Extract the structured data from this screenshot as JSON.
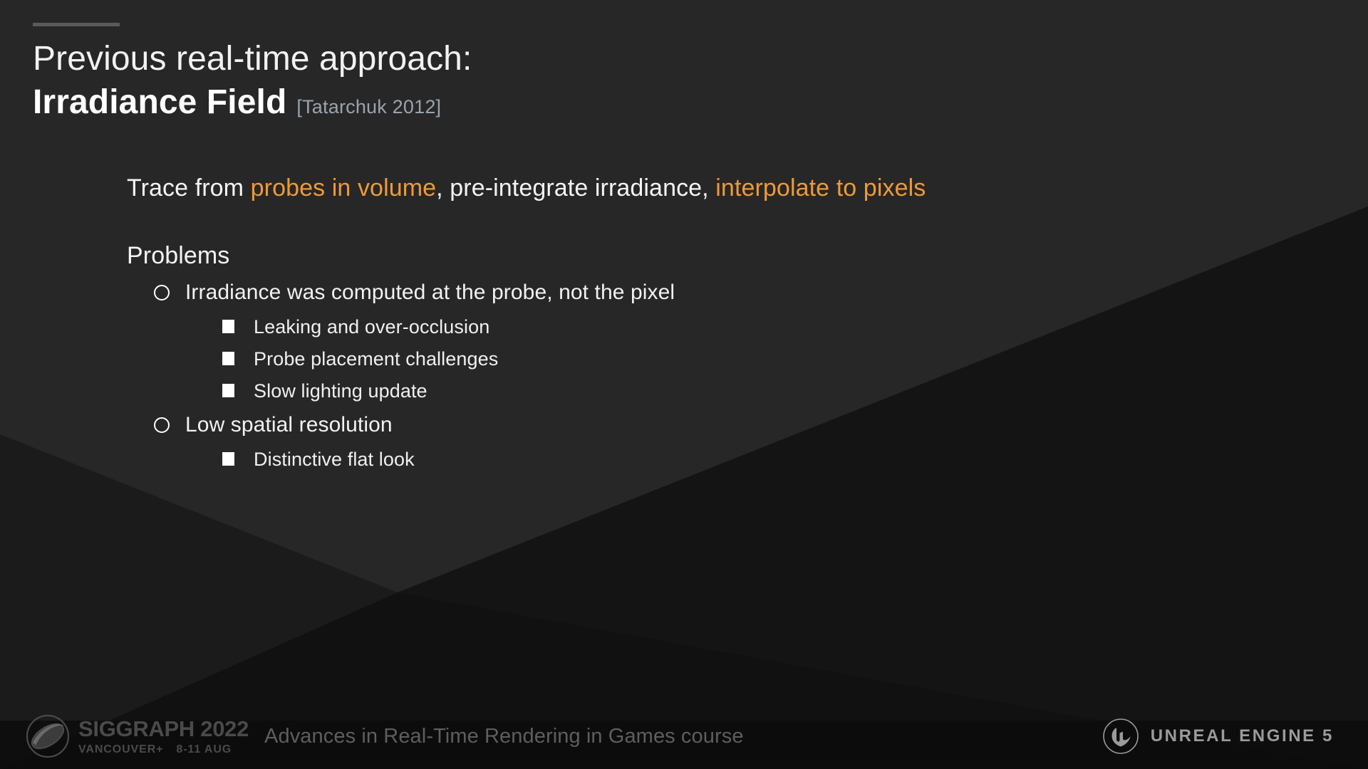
{
  "slide": {
    "accent_rule_color": "#5a5a5a",
    "background_color": "#272727",
    "highlight_color": "#ef9a34",
    "citation_color": "#9aa3ad"
  },
  "title": {
    "line1": "Previous real-time approach:",
    "main": "Irradiance Field",
    "citation": "[Tatarchuk 2012]"
  },
  "body": {
    "lead": {
      "part1": "Trace from ",
      "highlight1": "probes in volume",
      "part2": ", pre-integrate irradiance, ",
      "highlight2": "interpolate to pixels"
    },
    "problems_heading": "Problems",
    "bullets": [
      {
        "level": 1,
        "text": "Irradiance was computed at the probe, not the pixel",
        "marker": "hollow-circle"
      },
      {
        "level": 2,
        "text": "Leaking and over-occlusion",
        "marker": "filled-square"
      },
      {
        "level": 2,
        "text": "Probe placement challenges",
        "marker": "filled-square"
      },
      {
        "level": 2,
        "text": "Slow lighting update",
        "marker": "filled-square"
      },
      {
        "level": 1,
        "text": "Low spatial resolution",
        "marker": "hollow-circle"
      },
      {
        "level": 2,
        "text": "Distinctive flat look",
        "marker": "filled-square"
      }
    ]
  },
  "footer": {
    "siggraph_title": "SIGGRAPH 2022",
    "siggraph_location": "VANCOUVER+",
    "siggraph_dates": "8-11 AUG",
    "course_title": "Advances in Real-Time Rendering in Games course",
    "unreal_label": "UNREAL ENGINE 5"
  }
}
